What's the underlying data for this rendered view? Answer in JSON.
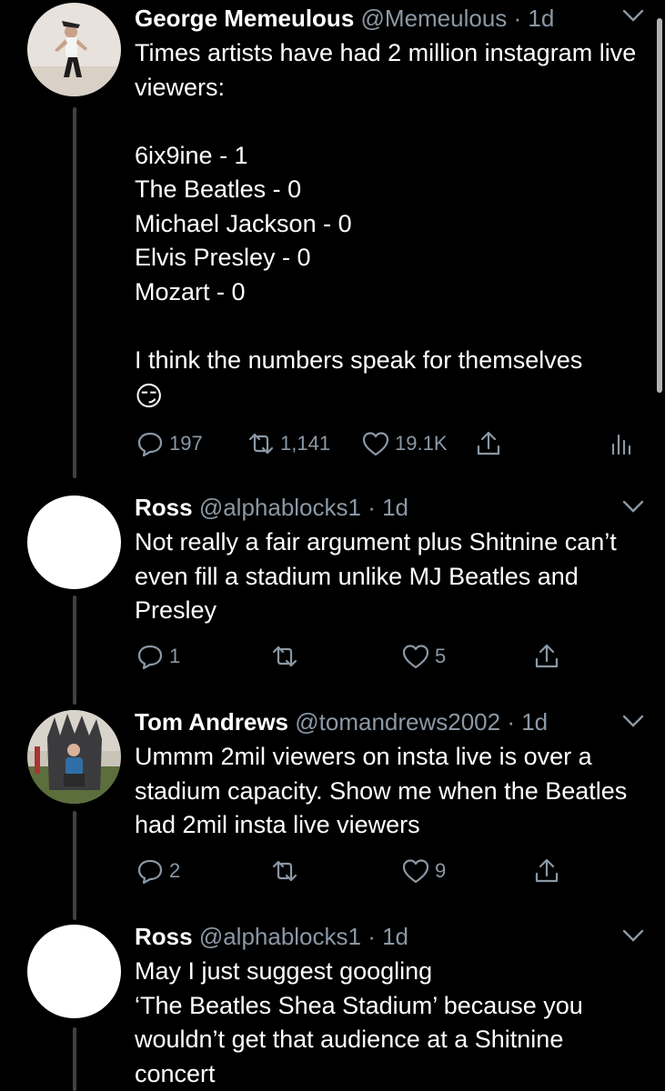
{
  "tweets": [
    {
      "name": "George Memeulous",
      "handle": "@Memeulous",
      "time": "1d",
      "text": "Times artists have had 2 million instagram live viewers:\n\n6ix9ine - 1\nThe Beatles - 0\nMichael Jackson - 0\nElvis Presley - 0\nMozart - 0\n\nI think the numbers speak for themselves",
      "emoji": "😏",
      "replies": "197",
      "retweets": "1,141",
      "likes": "19.1K"
    },
    {
      "name": "Ross",
      "handle": "@alphablocks1",
      "time": "1d",
      "text": "Not really a fair argument plus Shitnine can’t even fill a stadium unlike MJ Beatles and Presley",
      "replies": "1",
      "retweets": "",
      "likes": "5"
    },
    {
      "name": "Tom Andrews",
      "handle": "@tomandrews2002",
      "time": "1d",
      "text": "Ummm 2mil viewers on insta live is over a stadium capacity. Show me when the Beatles had 2mil insta live viewers",
      "replies": "2",
      "retweets": "",
      "likes": "9"
    },
    {
      "name": "Ross",
      "handle": "@alphablocks1",
      "time": "1d",
      "text": "May I just suggest googling\n‘The Beatles Shea Stadium’ because you wouldn’t get that audience at a Shitnine concert"
    }
  ],
  "colors": {
    "background": "#000000",
    "secondary_text": "#8b98a5",
    "thread_line": "#3d4248"
  }
}
